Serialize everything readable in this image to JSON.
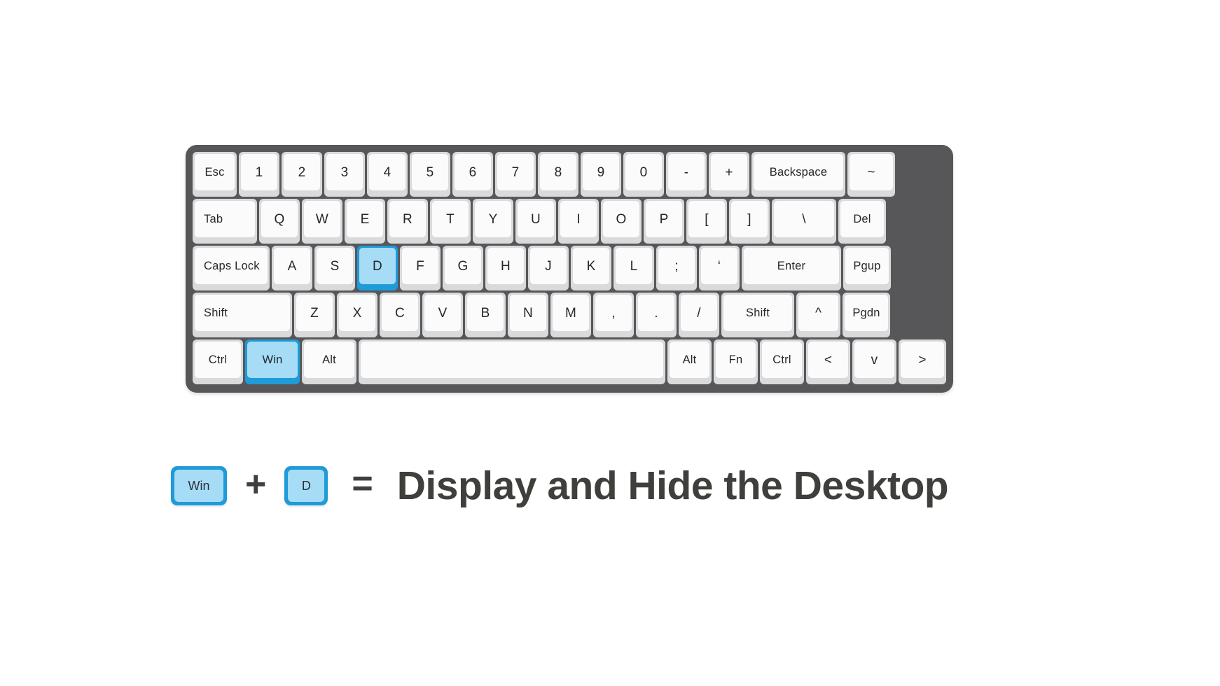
{
  "keyboard": {
    "rows": [
      {
        "name": "number-row",
        "keys": [
          {
            "label": "Esc",
            "w": "w-esc",
            "size": "small",
            "align": "center",
            "hl": false
          },
          {
            "label": "1",
            "w": "w-1",
            "size": "norm",
            "align": "center",
            "hl": false
          },
          {
            "label": "2",
            "w": "w-1",
            "size": "norm",
            "align": "center",
            "hl": false
          },
          {
            "label": "3",
            "w": "w-1",
            "size": "norm",
            "align": "center",
            "hl": false
          },
          {
            "label": "4",
            "w": "w-1",
            "size": "norm",
            "align": "center",
            "hl": false
          },
          {
            "label": "5",
            "w": "w-1",
            "size": "norm",
            "align": "center",
            "hl": false
          },
          {
            "label": "6",
            "w": "w-1",
            "size": "norm",
            "align": "center",
            "hl": false
          },
          {
            "label": "7",
            "w": "w-1",
            "size": "norm",
            "align": "center",
            "hl": false
          },
          {
            "label": "8",
            "w": "w-1",
            "size": "norm",
            "align": "center",
            "hl": false
          },
          {
            "label": "9",
            "w": "w-1",
            "size": "norm",
            "align": "center",
            "hl": false
          },
          {
            "label": "0",
            "w": "w-1",
            "size": "norm",
            "align": "center",
            "hl": false
          },
          {
            "label": "-",
            "w": "w-1",
            "size": "norm",
            "align": "center",
            "hl": false
          },
          {
            "label": "+",
            "w": "w-1",
            "size": "norm",
            "align": "center",
            "hl": false
          },
          {
            "label": "Backspace",
            "w": "w-bksp",
            "size": "small",
            "align": "center",
            "hl": false
          },
          {
            "label": "~",
            "w": "w-edge",
            "size": "norm",
            "align": "center",
            "hl": false
          }
        ]
      },
      {
        "name": "qwerty-row",
        "keys": [
          {
            "label": "Tab",
            "w": "w-tab",
            "size": "small",
            "align": "left",
            "hl": false
          },
          {
            "label": "Q",
            "w": "w-1",
            "size": "norm",
            "align": "center",
            "hl": false
          },
          {
            "label": "W",
            "w": "w-1",
            "size": "norm",
            "align": "center",
            "hl": false
          },
          {
            "label": "E",
            "w": "w-1",
            "size": "norm",
            "align": "center",
            "hl": false
          },
          {
            "label": "R",
            "w": "w-1",
            "size": "norm",
            "align": "center",
            "hl": false
          },
          {
            "label": "T",
            "w": "w-1",
            "size": "norm",
            "align": "center",
            "hl": false
          },
          {
            "label": "Y",
            "w": "w-1",
            "size": "norm",
            "align": "center",
            "hl": false
          },
          {
            "label": "U",
            "w": "w-1",
            "size": "norm",
            "align": "center",
            "hl": false
          },
          {
            "label": "I",
            "w": "w-1",
            "size": "norm",
            "align": "center",
            "hl": false
          },
          {
            "label": "O",
            "w": "w-1",
            "size": "norm",
            "align": "center",
            "hl": false
          },
          {
            "label": "P",
            "w": "w-1",
            "size": "norm",
            "align": "center",
            "hl": false
          },
          {
            "label": "[",
            "w": "w-1",
            "size": "norm",
            "align": "center",
            "hl": false
          },
          {
            "label": "]",
            "w": "w-1",
            "size": "norm",
            "align": "center",
            "hl": false
          },
          {
            "label": "\\",
            "w": "w-backsl",
            "size": "norm",
            "align": "center",
            "hl": false
          },
          {
            "label": "Del",
            "w": "w-edge",
            "size": "small",
            "align": "center",
            "hl": false
          }
        ]
      },
      {
        "name": "home-row",
        "keys": [
          {
            "label": "Caps Lock",
            "w": "w-caps",
            "size": "small",
            "align": "left",
            "hl": false
          },
          {
            "label": "A",
            "w": "w-1",
            "size": "norm",
            "align": "center",
            "hl": false
          },
          {
            "label": "S",
            "w": "w-1",
            "size": "norm",
            "align": "center",
            "hl": false
          },
          {
            "label": "D",
            "w": "w-1",
            "size": "norm",
            "align": "center",
            "hl": true
          },
          {
            "label": "F",
            "w": "w-1",
            "size": "norm",
            "align": "center",
            "hl": false
          },
          {
            "label": "G",
            "w": "w-1",
            "size": "norm",
            "align": "center",
            "hl": false
          },
          {
            "label": "H",
            "w": "w-1",
            "size": "norm",
            "align": "center",
            "hl": false
          },
          {
            "label": "J",
            "w": "w-1",
            "size": "norm",
            "align": "center",
            "hl": false
          },
          {
            "label": "K",
            "w": "w-1",
            "size": "norm",
            "align": "center",
            "hl": false
          },
          {
            "label": "L",
            "w": "w-1",
            "size": "norm",
            "align": "center",
            "hl": false
          },
          {
            "label": ";",
            "w": "w-1",
            "size": "norm",
            "align": "center",
            "hl": false
          },
          {
            "label": "‘",
            "w": "w-1",
            "size": "norm",
            "align": "center",
            "hl": false
          },
          {
            "label": "Enter",
            "w": "w-enter",
            "size": "small",
            "align": "center",
            "hl": false
          },
          {
            "label": "Pgup",
            "w": "w-edge",
            "size": "small",
            "align": "center",
            "hl": false
          }
        ]
      },
      {
        "name": "shift-row",
        "keys": [
          {
            "label": "Shift",
            "w": "w-shiftL",
            "size": "small",
            "align": "left",
            "hl": false
          },
          {
            "label": "Z",
            "w": "w-1",
            "size": "norm",
            "align": "center",
            "hl": false
          },
          {
            "label": "X",
            "w": "w-1",
            "size": "norm",
            "align": "center",
            "hl": false
          },
          {
            "label": "C",
            "w": "w-1",
            "size": "norm",
            "align": "center",
            "hl": false
          },
          {
            "label": "V",
            "w": "w-1",
            "size": "norm",
            "align": "center",
            "hl": false
          },
          {
            "label": "B",
            "w": "w-1",
            "size": "norm",
            "align": "center",
            "hl": false
          },
          {
            "label": "N",
            "w": "w-1",
            "size": "norm",
            "align": "center",
            "hl": false
          },
          {
            "label": "M",
            "w": "w-1",
            "size": "norm",
            "align": "center",
            "hl": false
          },
          {
            "label": ",",
            "w": "w-1",
            "size": "norm",
            "align": "center",
            "hl": false
          },
          {
            "label": ".",
            "w": "w-1",
            "size": "norm",
            "align": "center",
            "hl": false
          },
          {
            "label": "/",
            "w": "w-1",
            "size": "norm",
            "align": "center",
            "hl": false
          },
          {
            "label": "Shift",
            "w": "w-shiftR",
            "size": "small",
            "align": "center",
            "hl": false
          },
          {
            "label": "^",
            "w": "w-mod",
            "size": "norm",
            "align": "center",
            "hl": false
          },
          {
            "label": "Pgdn",
            "w": "w-edge",
            "size": "small",
            "align": "center",
            "hl": false
          }
        ]
      },
      {
        "name": "bottom-row",
        "keys": [
          {
            "label": "Ctrl",
            "w": "w-ctrlL",
            "size": "small",
            "align": "center",
            "hl": false
          },
          {
            "label": "Win",
            "w": "w-winL",
            "size": "small",
            "align": "center",
            "hl": true
          },
          {
            "label": "Alt",
            "w": "w-altL",
            "size": "small",
            "align": "center",
            "hl": false
          },
          {
            "label": "",
            "w": "w-space",
            "size": "blank",
            "align": "center",
            "hl": false
          },
          {
            "label": "Alt",
            "w": "w-mod",
            "size": "small",
            "align": "center",
            "hl": false
          },
          {
            "label": "Fn",
            "w": "w-mod",
            "size": "small",
            "align": "center",
            "hl": false
          },
          {
            "label": "Ctrl",
            "w": "w-mod",
            "size": "small",
            "align": "center",
            "hl": false
          },
          {
            "label": "<",
            "w": "w-mod",
            "size": "norm",
            "align": "center",
            "hl": false
          },
          {
            "label": "v",
            "w": "w-mod",
            "size": "norm",
            "align": "center",
            "hl": false
          },
          {
            "label": ">",
            "w": "w-edge",
            "size": "norm",
            "align": "center",
            "hl": false
          }
        ]
      }
    ]
  },
  "caption": {
    "win_key_label": "Win",
    "d_key_label": "D",
    "plus_symbol": "+",
    "equals_symbol": "=",
    "description": "Display and Hide the Desktop"
  },
  "colors": {
    "frame": "#57575a",
    "key_base": "#d9dadb",
    "key_cap": "#fbfbfb",
    "highlight_outer": "#1e9bd8",
    "highlight_cap": "#a7dcf6",
    "text_dark": "#3f3f3b",
    "background": "#ffffff"
  }
}
